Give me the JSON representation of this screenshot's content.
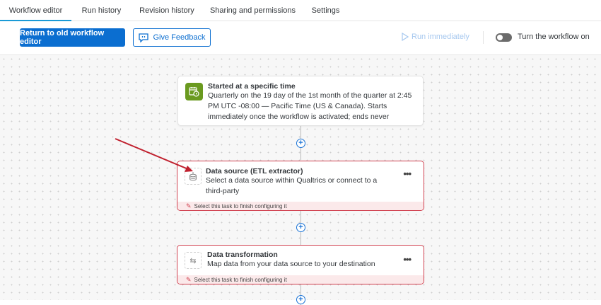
{
  "tabs": [
    {
      "label": "Workflow editor",
      "active": true
    },
    {
      "label": "Run history"
    },
    {
      "label": "Revision history"
    },
    {
      "label": "Sharing and permissions"
    },
    {
      "label": "Settings"
    }
  ],
  "toolbar": {
    "return_label": "Return to old workflow editor",
    "feedback_label": "Give Feedback",
    "run_label": "Run immediately",
    "toggle_label": "Turn the workflow on",
    "toggle_on": false
  },
  "nodes": {
    "trigger": {
      "title": "Started at a specific time",
      "desc": "Quarterly on the 19 day of the 1st month of the quarter at 2:45 PM UTC -08:00 — Pacific Time (US & Canada). Starts immediately once the workflow is activated; ends never"
    },
    "source": {
      "title": "Data source (ETL extractor)",
      "desc": "Select a data source within Qualtrics or connect to a third-party",
      "warning": "Select this task to finish configuring it"
    },
    "transform": {
      "title": "Data transformation",
      "desc": "Map data from your data source to your destination",
      "warning": "Select this task to finish configuring it"
    }
  },
  "colors": {
    "primary": "#0b6ed0",
    "error": "#d0404f",
    "trigger": "#6a9a1f",
    "arrow": "#c0202e"
  }
}
